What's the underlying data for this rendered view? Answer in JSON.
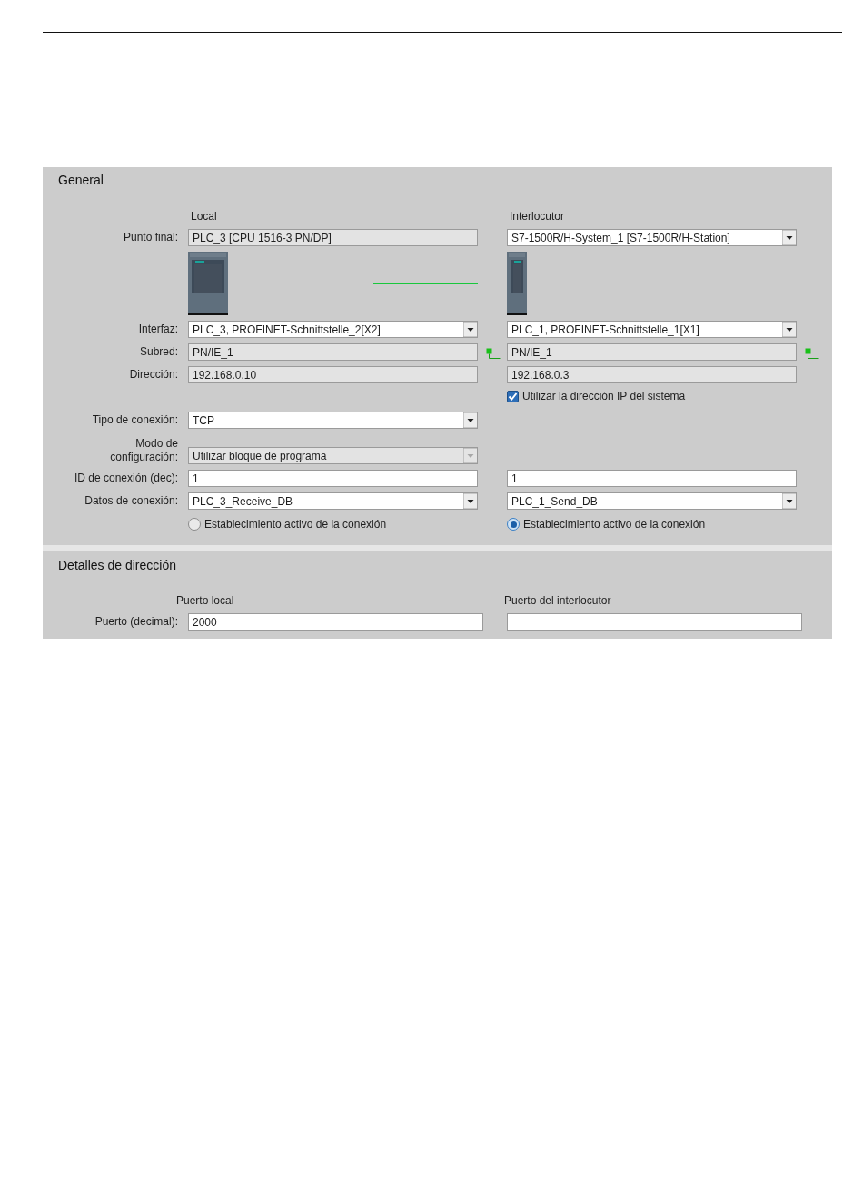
{
  "general": {
    "title": "General",
    "local_heading": "Local",
    "partner_heading": "Interlocutor",
    "rows": [
      {
        "kind": "field",
        "label": "Punto final:",
        "local": {
          "kind": "readonly",
          "value": "PLC_3 [CPU 1516-3 PN/DP]"
        },
        "partner": {
          "kind": "dropdown",
          "value": "S7-1500R/H-System_1 [S7-1500R/H-Station]",
          "disabled": false
        }
      },
      {
        "kind": "devices"
      },
      {
        "kind": "field",
        "label": "Interfaz:",
        "local": {
          "kind": "dropdown",
          "value": "PLC_3, PROFINET-Schnittstelle_2[X2]",
          "disabled": false
        },
        "partner": {
          "kind": "dropdown",
          "value": "PLC_1, PROFINET-Schnittstelle_1[X1]",
          "disabled": false
        }
      },
      {
        "kind": "field",
        "label": "Subred:",
        "local": {
          "kind": "readonly",
          "value": "PN/IE_1",
          "network_icon": true
        },
        "partner": {
          "kind": "readonly",
          "value": "PN/IE_1",
          "network_icon": true
        }
      },
      {
        "kind": "field",
        "label": "Dirección:",
        "local": {
          "kind": "readonly",
          "value": "192.168.0.10"
        },
        "partner": {
          "kind": "readonly",
          "value": "192.168.0.3"
        }
      },
      {
        "kind": "checkbox",
        "partner": {
          "label": "Utilizar la dirección IP del sistema",
          "checked": true
        }
      },
      {
        "kind": "field",
        "label": "Tipo de conexión:",
        "local": {
          "kind": "dropdown",
          "value": "TCP",
          "disabled": false
        }
      },
      {
        "kind": "field",
        "label": "Modo de\nconfiguración:",
        "local": {
          "kind": "dropdown",
          "value": "Utilizar bloque de programa",
          "disabled": true
        }
      },
      {
        "kind": "field",
        "label": "ID de conexión (dec):",
        "local": {
          "kind": "text",
          "value": "1"
        },
        "partner": {
          "kind": "text",
          "value": "1"
        }
      },
      {
        "kind": "field",
        "label": "Datos de conexión:",
        "local": {
          "kind": "dropdown",
          "value": "PLC_3_Receive_DB",
          "disabled": false
        },
        "partner": {
          "kind": "dropdown",
          "value": "PLC_1_Send_DB",
          "disabled": false
        }
      },
      {
        "kind": "radio",
        "local": {
          "label": "Establecimiento activo de la conexión",
          "selected": false
        },
        "partner": {
          "label": "Establecimiento activo de la conexión",
          "selected": true
        }
      }
    ]
  },
  "address": {
    "title": "Detalles de dirección",
    "local_heading": "Puerto local",
    "partner_heading": "Puerto del interlocutor",
    "label": "Puerto (decimal):",
    "local": {
      "kind": "text",
      "value": "2000"
    },
    "partner": {
      "kind": "text"
    }
  }
}
